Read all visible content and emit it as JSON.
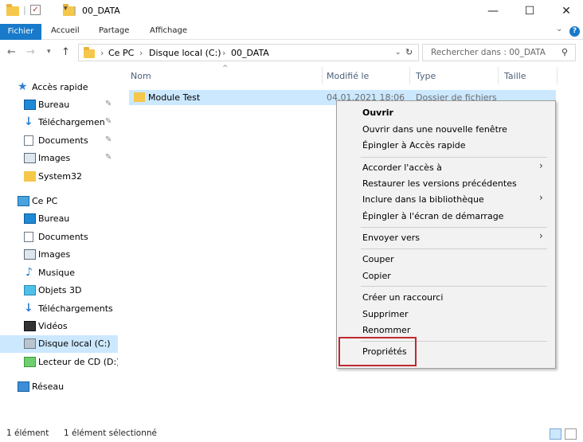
{
  "window": {
    "title": "00_DATA",
    "controls": {
      "minimize": "—",
      "maximize": "☐",
      "close": "✕"
    }
  },
  "ribbon": {
    "tabs": [
      "Fichier",
      "Accueil",
      "Partage",
      "Affichage"
    ],
    "expand": "⌄",
    "help": "?"
  },
  "address": {
    "crumbs": [
      "Ce PC",
      "Disque local (C:)",
      "00_DATA"
    ],
    "search_placeholder": "Rechercher dans : 00_DATA"
  },
  "sidebar": {
    "items": [
      {
        "label": "Accès rapide",
        "icon": "star-icon"
      },
      {
        "label": "Bureau",
        "icon": "desktop-icon",
        "pinned": true
      },
      {
        "label": "Téléchargements",
        "icon": "download-icon",
        "pinned": true
      },
      {
        "label": "Documents",
        "icon": "document-icon",
        "pinned": true
      },
      {
        "label": "Images",
        "icon": "image-icon",
        "pinned": true
      },
      {
        "label": "System32",
        "icon": "folder-icon"
      },
      {
        "label": "Ce PC",
        "icon": "computer-icon"
      },
      {
        "label": "Bureau",
        "icon": "desktop-icon"
      },
      {
        "label": "Documents",
        "icon": "document-icon"
      },
      {
        "label": "Images",
        "icon": "image-icon"
      },
      {
        "label": "Musique",
        "icon": "music-icon"
      },
      {
        "label": "Objets 3D",
        "icon": "cube-icon"
      },
      {
        "label": "Téléchargements",
        "icon": "download-icon"
      },
      {
        "label": "Vidéos",
        "icon": "video-icon"
      },
      {
        "label": "Disque local (C:)",
        "icon": "drive-icon",
        "selected": true
      },
      {
        "label": "Lecteur de CD (D:) S",
        "icon": "cd-drive-icon"
      },
      {
        "label": "Réseau",
        "icon": "network-icon"
      }
    ]
  },
  "filelist": {
    "columns": [
      "Nom",
      "Modifié le",
      "Type",
      "Taille"
    ],
    "rows": [
      {
        "name": "Module Test",
        "modified": "04.01.2021 18:06",
        "type": "Dossier de fichiers"
      }
    ]
  },
  "context_menu": {
    "items": [
      "Ouvrir",
      "Ouvrir dans une nouvelle fenêtre",
      "Épingler à Accès rapide",
      "Accorder l'accès à",
      "Restaurer les versions précédentes",
      "Inclure dans la bibliothèque",
      "Épingler à l'écran de démarrage",
      "Envoyer vers",
      "Couper",
      "Copier",
      "Créer un raccourci",
      "Supprimer",
      "Renommer",
      "Propriétés"
    ],
    "submenu_arrow": "›",
    "highlight_color": "#c0282f"
  },
  "status": {
    "count": "1 élément",
    "selection": "1 élément sélectionné"
  }
}
